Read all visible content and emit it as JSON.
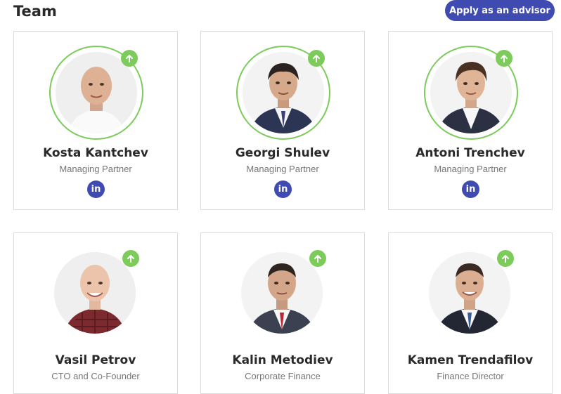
{
  "section": {
    "title": "Team"
  },
  "apply_button": {
    "label": "Apply as an advisor"
  },
  "linkedin_glyph": "in",
  "colors": {
    "accent": "#3f4bb0",
    "badge_green": "#7ccb5b",
    "card_border": "#dcdcdc"
  },
  "members": [
    {
      "name": "Kosta Kantchev",
      "role": "Managing Partner",
      "icon": "arrow-up-icon"
    },
    {
      "name": "Georgi Shulev",
      "role": "Managing Partner",
      "icon": "arrow-up-icon"
    },
    {
      "name": "Antoni Trenchev",
      "role": "Managing Partner",
      "icon": "arrow-up-icon"
    },
    {
      "name": "Vasil Petrov",
      "role": "CTO and Co-Founder",
      "icon": "arrow-up-icon"
    },
    {
      "name": "Kalin Metodiev",
      "role": "Corporate Finance",
      "icon": "arrow-up-icon"
    },
    {
      "name": "Kamen Trendafilov",
      "role": "Finance Director",
      "icon": "arrow-up-icon"
    }
  ]
}
